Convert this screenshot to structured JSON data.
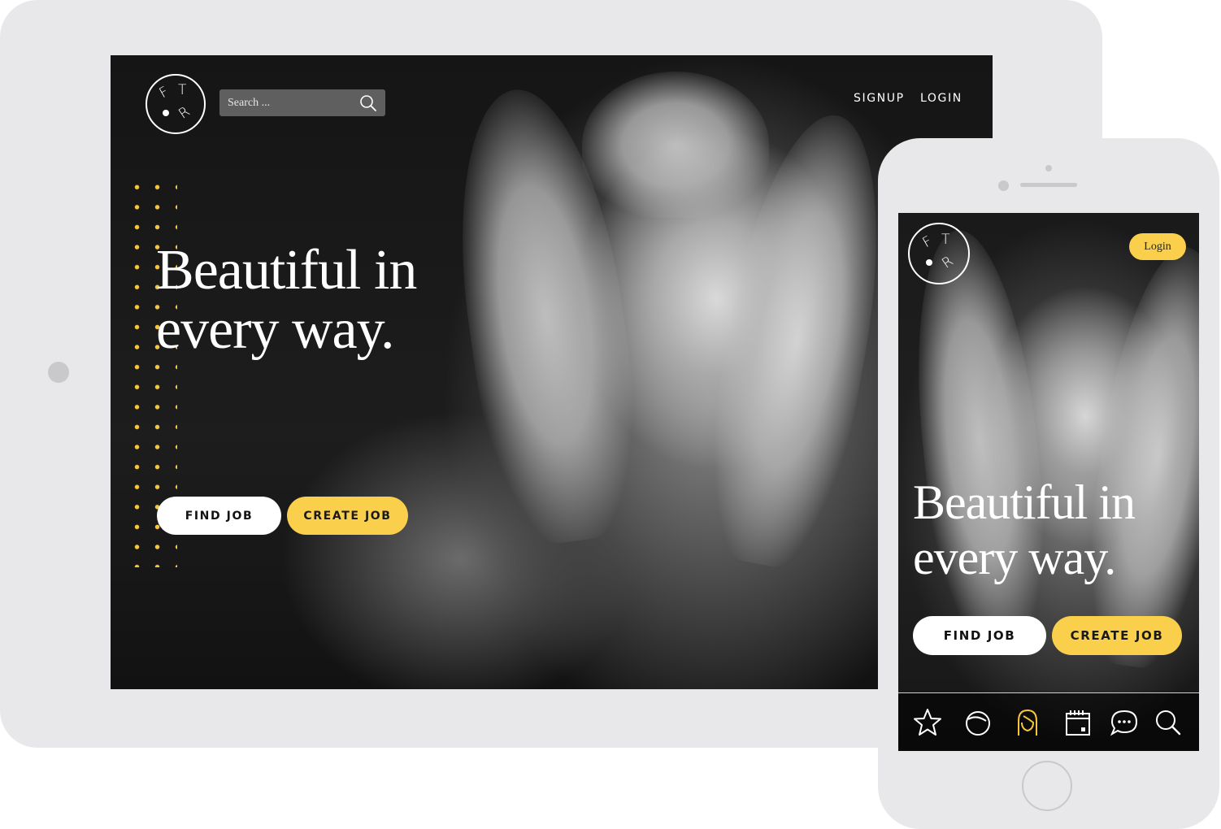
{
  "tablet": {
    "logo": {
      "letters": [
        "F",
        "T",
        "R"
      ]
    },
    "search": {
      "placeholder": "Search ..."
    },
    "nav": {
      "signup": "SIGNUP",
      "login": "LOGIN"
    },
    "headline": {
      "line1": "Beautiful in",
      "line2": "every way."
    },
    "buttons": {
      "find_job": "FIND JOB",
      "create_job": "CREATE JOB"
    }
  },
  "phone": {
    "logo": {
      "letters": [
        "F",
        "T",
        "R"
      ]
    },
    "login": "Login",
    "headline": {
      "line1": "Beautiful in",
      "line2": "every way."
    },
    "buttons": {
      "find_job": "FIND JOB",
      "create_job": "CREATE JOB"
    },
    "tabs": [
      {
        "icon": "star-icon"
      },
      {
        "icon": "face-icon"
      },
      {
        "icon": "profile-icon",
        "active": true
      },
      {
        "icon": "calendar-icon"
      },
      {
        "icon": "chat-icon"
      },
      {
        "icon": "search-icon"
      }
    ]
  },
  "colors": {
    "accent": "#f9cf4b",
    "tab_active": "#f7c73a",
    "background_dark": "#151515"
  }
}
